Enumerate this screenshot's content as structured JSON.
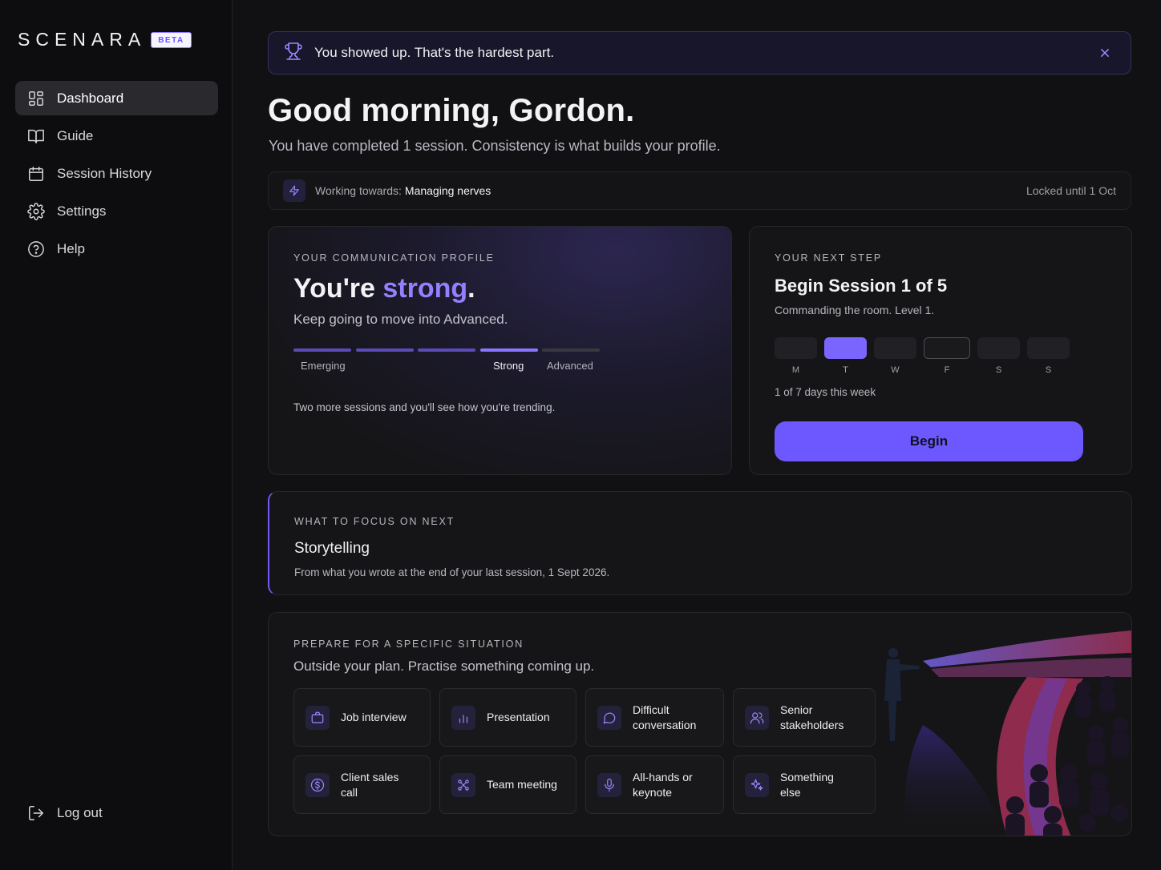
{
  "brand": {
    "name": "SCENARA",
    "badge": "BETA"
  },
  "sidebar": {
    "items": [
      {
        "label": "Dashboard",
        "icon": "dashboard-icon",
        "active": true
      },
      {
        "label": "Guide",
        "icon": "book-icon"
      },
      {
        "label": "Session History",
        "icon": "calendar-icon"
      },
      {
        "label": "Settings",
        "icon": "gear-icon"
      },
      {
        "label": "Help",
        "icon": "help-icon"
      }
    ],
    "logout": "Log out"
  },
  "banner": {
    "text": "You showed up. That's the hardest part.",
    "icon": "trophy-icon"
  },
  "greeting": "Good morning, Gordon.",
  "subtitle": "You have completed 1 session. Consistency is what builds your profile.",
  "goal": {
    "label": "Working towards:",
    "value": "Managing nerves",
    "lock": "Locked until 1 Oct"
  },
  "profile": {
    "eyebrow": "Your communication profile",
    "title_prefix": "You're ",
    "title_highlight": "strong",
    "title_suffix": ".",
    "sub": "Keep going to move into Advanced.",
    "levels": [
      "Emerging",
      "Strong",
      "Advanced"
    ],
    "segments_filled": 4,
    "segments_total": 5,
    "note": "Two more sessions and you'll see how you're trending."
  },
  "next_step": {
    "eyebrow": "Your next step",
    "title": "Begin Session 1 of 5",
    "sub": "Commanding the room. Level 1.",
    "days": [
      "M",
      "T",
      "W",
      "F",
      "S",
      "S"
    ],
    "week_text": "1 of 7 days this week",
    "button": "Begin"
  },
  "focus": {
    "eyebrow": "What to focus on next",
    "title": "Storytelling",
    "note": "From what you wrote at the end of your last session, 1 Sept 2026."
  },
  "prepare": {
    "eyebrow": "Prepare for a specific situation",
    "sub": "Outside your plan. Practise something coming up.",
    "tiles": [
      {
        "label": "Job interview",
        "icon": "briefcase-icon"
      },
      {
        "label": "Presentation",
        "icon": "bar-chart-icon"
      },
      {
        "label": "Difficult conversation",
        "icon": "chat-icon"
      },
      {
        "label": "Senior stakeholders",
        "icon": "users-icon"
      },
      {
        "label": "Client sales call",
        "icon": "dollar-icon"
      },
      {
        "label": "Team meeting",
        "icon": "network-icon"
      },
      {
        "label": "All-hands or keynote",
        "icon": "microphone-icon"
      },
      {
        "label": "Something else",
        "icon": "sparkle-icon"
      }
    ]
  },
  "colors": {
    "accent": "#6d58ff",
    "accent_text": "#9480ff",
    "background": "#111113"
  }
}
